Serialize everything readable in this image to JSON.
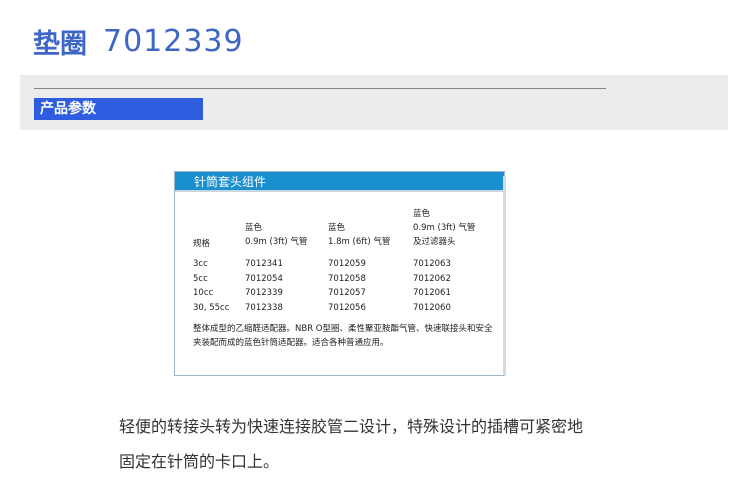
{
  "title": {
    "name": "垫圈",
    "number": "7012339"
  },
  "section": {
    "label": "产品参数"
  },
  "spec_table": {
    "header": "针筒套头组件",
    "columns": [
      {
        "lines": [
          "规格"
        ]
      },
      {
        "lines": [
          "蓝色",
          "0.9m (3ft) 气管"
        ]
      },
      {
        "lines": [
          "蓝色",
          "1.8m (6ft)  气管"
        ]
      },
      {
        "lines": [
          "蓝色",
          "0.9m (3ft) 气管",
          "及过滤器头"
        ]
      }
    ],
    "rows": [
      [
        "3cc",
        "7012341",
        "7012059",
        "7012063"
      ],
      [
        "5cc",
        "7012054",
        "7012058",
        "7012062"
      ],
      [
        "10cc",
        "7012339",
        "7012057",
        "7012061"
      ],
      [
        "30, 55cc",
        "7012338",
        "7012056",
        "7012060"
      ]
    ],
    "note": "整体成型的乙缩醛适配器。NBR O型圈、柔性聚亚胺酯气管、快速联接头和安全夹装配而成的蓝色针筒适配器。适合各种普通应用。"
  },
  "description": "轻便的转接头转为快速连接胶管二设计，特殊设计的插槽可紧密地固定在针筒的卡口上。"
}
